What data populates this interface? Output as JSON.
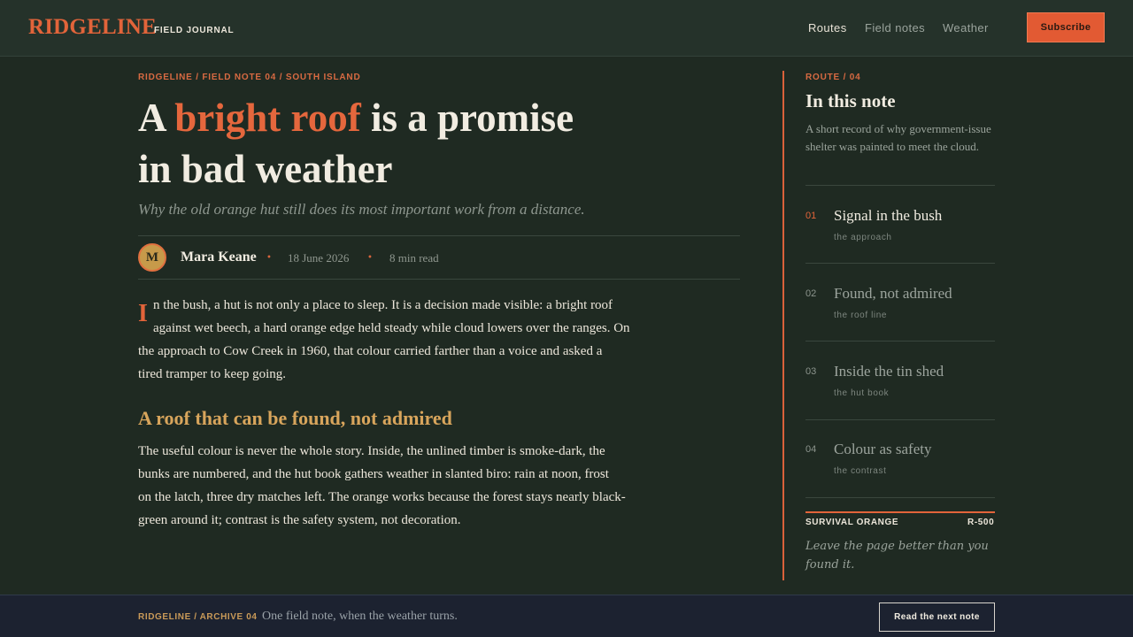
{
  "header": {
    "brand": "RIDGELINE",
    "brand_sub": "FIELD JOURNAL",
    "nav": [
      {
        "label": "Routes",
        "active": true
      },
      {
        "label": "Field notes",
        "active": false
      },
      {
        "label": "Weather",
        "active": false
      }
    ],
    "subscribe_label": "Subscribe"
  },
  "article": {
    "breadcrumb": "RIDGELINE / FIELD NOTE 04 / SOUTH ISLAND",
    "headline_pre": "A ",
    "headline_highlight": "bright roof",
    "headline_post_line1": " is a promise",
    "headline_line2": "in bad weather",
    "dek": "Why the old orange hut still does its most important work from a distance.",
    "author_initial": "M",
    "author": "Mara Keane",
    "date": "18 June 2026",
    "read_time": "8 min read",
    "dropcap": "I",
    "para1_lines": [
      "n the bush, a hut is not only a place to sleep. It is a decision made visible: a bright roof",
      "against wet beech, a hard orange edge held steady while cloud lowers over the ranges. On",
      "the approach to Cow Creek in 1960, that colour carried farther than a voice and asked a",
      "tired tramper to keep going."
    ],
    "subhead": "A roof that can be found, not admired",
    "para2_lines": [
      "The useful colour is never the whole story. Inside, the unlined timber is smoke-dark, the",
      "bunks are numbered, and the hut book gathers weather in slanted biro: rain at noon, frost",
      "on the latch, three dry matches left. The orange works because the forest stays nearly black-",
      "green around it; contrast is the safety system, not decoration."
    ]
  },
  "sidebar": {
    "route_label": "ROUTE / 04",
    "title": "In this note",
    "description": "A short record of why government-issue shelter was painted to meet the cloud.",
    "toc": [
      {
        "num": "01",
        "title": "Signal in the bush",
        "sub": "the approach",
        "active": true
      },
      {
        "num": "02",
        "title": "Found, not admired",
        "sub": "the roof line",
        "active": false
      },
      {
        "num": "03",
        "title": "Inside the tin shed",
        "sub": "the hut book",
        "active": false
      },
      {
        "num": "04",
        "title": "Colour as safety",
        "sub": "the contrast",
        "active": false
      }
    ],
    "swatch_name": "SURVIVAL ORANGE",
    "swatch_code": "R-500",
    "motto": "Leave the page better than you found it."
  },
  "footer": {
    "label": "RIDGELINE / ARCHIVE 04",
    "text": "One field note, when the weather turns.",
    "next_label": "Read the next note"
  },
  "colors": {
    "accent": "#e2643a",
    "background": "#1f2a22",
    "subhead": "#d8a55c",
    "footer_bg": "#1c2230"
  }
}
